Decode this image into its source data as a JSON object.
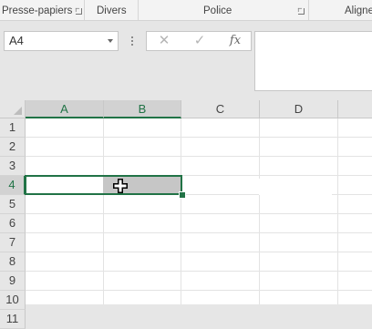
{
  "ribbon": {
    "groups": [
      {
        "label": "Presse-papiers"
      },
      {
        "label": "Divers"
      },
      {
        "label": "Police"
      },
      {
        "label": "Aligne"
      }
    ]
  },
  "formula_bar": {
    "name_box_value": "A4",
    "cancel_symbol": "✕",
    "enter_symbol": "✓",
    "fx_symbol": "fx",
    "formula_value": ""
  },
  "sheet": {
    "columns": [
      "A",
      "B",
      "C",
      "D"
    ],
    "rows": [
      "1",
      "2",
      "3",
      "4",
      "5",
      "6",
      "7",
      "8",
      "9",
      "10",
      "11"
    ],
    "selected_row": "4",
    "selected_columns": [
      "A",
      "B"
    ],
    "active_cell": "A4",
    "selected_range": "A4:B4"
  },
  "colors": {
    "accent": "#217346",
    "header_bg": "#e6e6e6",
    "selection_fill": "#c6c6c6"
  }
}
